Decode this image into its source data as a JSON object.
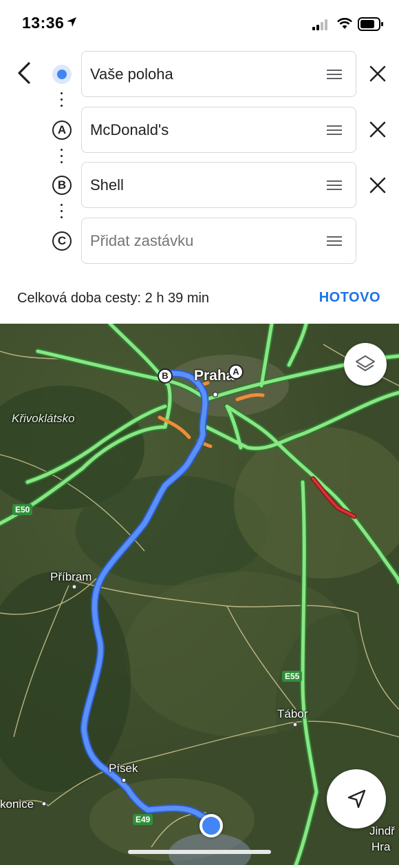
{
  "status_bar": {
    "time": "13:36",
    "location_icon": "location-arrow-icon",
    "signal_icon": "cellular-signal-icon",
    "wifi_icon": "wifi-icon",
    "battery_icon": "battery-icon"
  },
  "directions": {
    "back_icon": "chevron-left-icon",
    "stops": [
      {
        "marker": "",
        "marker_type": "current-location-dot",
        "value": "Vaše poloha",
        "placeholder": ""
      },
      {
        "marker": "A",
        "marker_type": "letter",
        "value": "McDonald's",
        "placeholder": ""
      },
      {
        "marker": "B",
        "marker_type": "letter",
        "value": "Shell",
        "placeholder": ""
      },
      {
        "marker": "C",
        "marker_type": "letter",
        "value": "",
        "placeholder": "Přidat zastávku"
      }
    ],
    "drag_icon": "drag-handle-icon",
    "remove_icon": "close-icon",
    "total_time": "Celková doba cesty: 2 h 39 min",
    "done_label": "HOTOVO"
  },
  "map": {
    "labels": {
      "praha": "Praha",
      "krivoklatsko": "Křivoklátsko",
      "pribram": "Příbram",
      "tabor": "Tábor",
      "pisek": "Písek",
      "konice": "konice",
      "jindr_1": "Jindř",
      "jindr_2": "Hra"
    },
    "shields": {
      "e50": "E50",
      "e55": "E55",
      "e49": "E49"
    },
    "pins": {
      "a": "A",
      "b": "B"
    },
    "layers_icon": "layers-icon",
    "recenter_icon": "navigation-arrow-icon",
    "colors": {
      "route": "#4f86f7",
      "traffic_free": "#7ed97a",
      "traffic_slow": "#f08c3a",
      "traffic_jam": "#c8252b",
      "accent": "#1a73e8"
    }
  }
}
